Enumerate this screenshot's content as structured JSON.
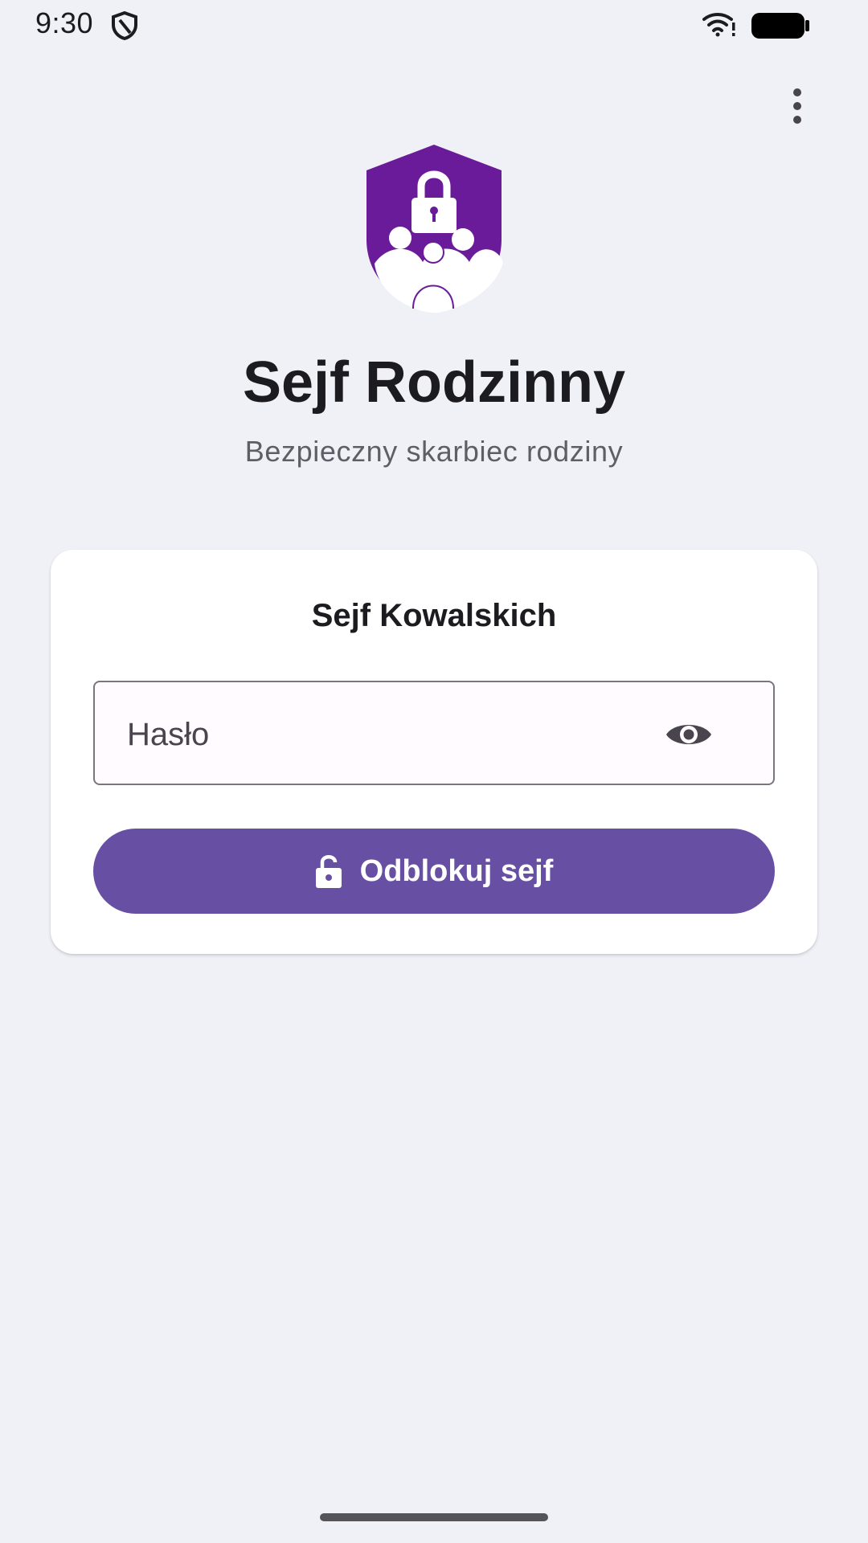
{
  "status_bar": {
    "time": "9:30",
    "icons": [
      "shield-icon",
      "wifi-icon",
      "battery-icon"
    ]
  },
  "toolbar": {
    "menu_icon": "more-vert-icon"
  },
  "header": {
    "logo_icon": "family-shield-lock-icon",
    "title": "Sejf Rodzinny",
    "subtitle": "Bezpieczny skarbiec rodziny"
  },
  "login_card": {
    "title": "Sejf Kowalskich",
    "password_field": {
      "placeholder": "Hasło",
      "value": "",
      "visibility_icon": "eye-icon"
    },
    "unlock_button": {
      "label": "Odblokuj sejf",
      "icon": "lock-open-icon"
    }
  },
  "colors": {
    "background": "#f0f1f6",
    "primary": "#6750a4",
    "logo_purple": "#6a1b9a",
    "card": "#ffffff",
    "text": "#1c1b1f",
    "subtitle": "#5f5e66"
  }
}
